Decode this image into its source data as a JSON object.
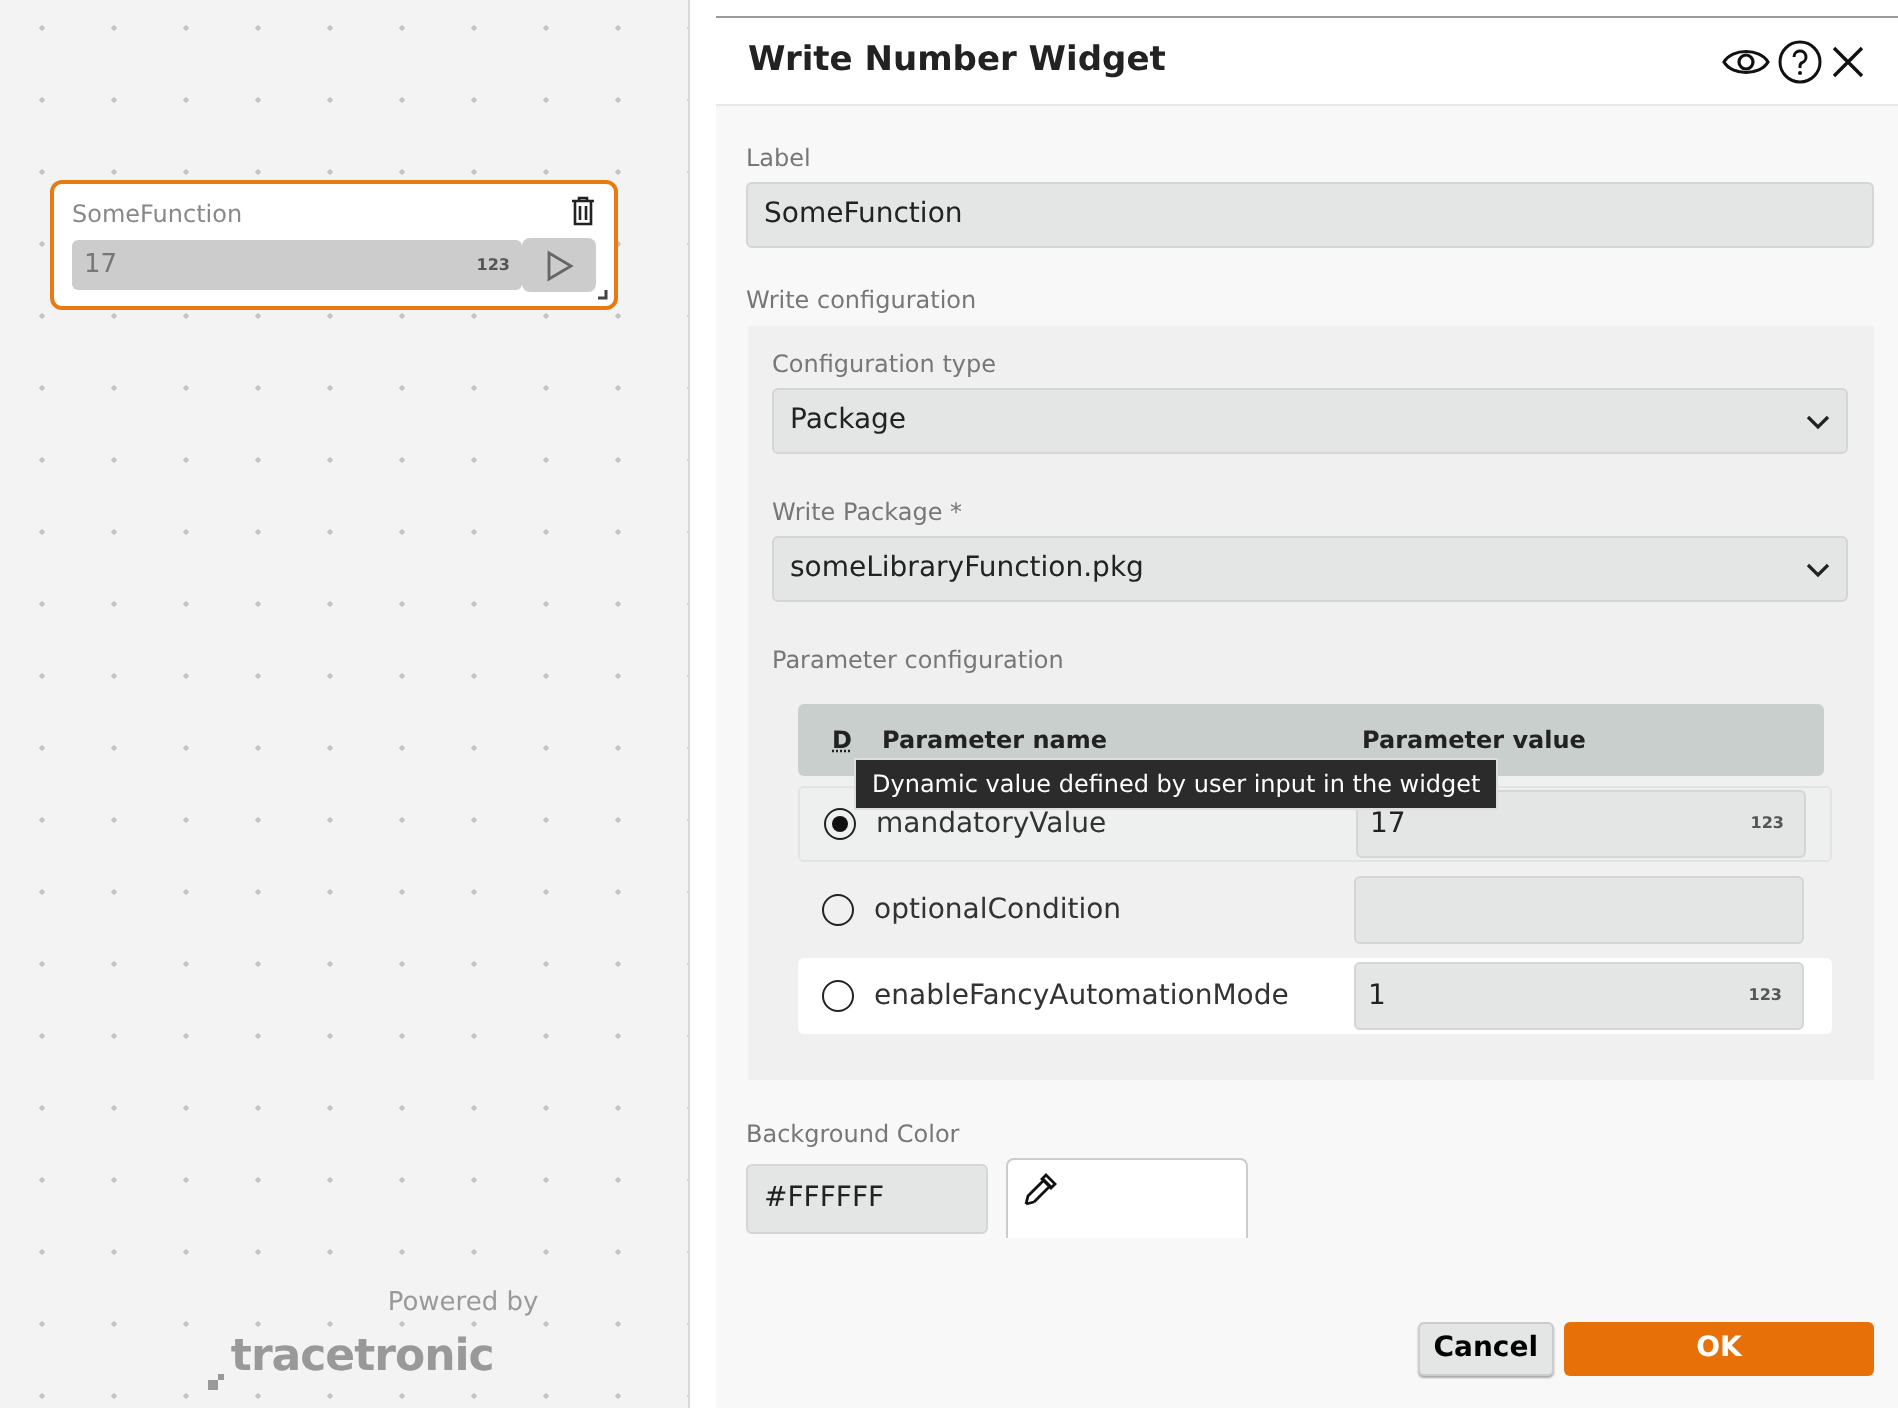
{
  "canvas": {
    "widget": {
      "label": "SomeFunction",
      "value": "17",
      "value_unit": "123",
      "selected": true
    },
    "footer": {
      "powered_by": "Powered by",
      "brand": "tracetronic"
    }
  },
  "dialog": {
    "title": "Write Number Widget",
    "label_field": {
      "label": "Label",
      "value": "SomeFunction"
    },
    "write_configuration": {
      "heading": "Write configuration",
      "configuration_type": {
        "label": "Configuration type",
        "value": "Package"
      },
      "write_package": {
        "label": "Write Package *",
        "value": "someLibraryFunction.pkg"
      },
      "parameter_configuration": {
        "heading": "Parameter configuration",
        "columns": [
          "D",
          "Parameter name",
          "Parameter value"
        ],
        "tooltip": "Dynamic value defined by user input in the widget",
        "rows": [
          {
            "name": "mandatoryValue",
            "value": "17",
            "unit": "123",
            "selected": true
          },
          {
            "name": "optionalCondition",
            "selected": false
          },
          {
            "name": "enableFancyAutomationMode",
            "value": "1",
            "unit": "123",
            "selected": false
          }
        ]
      }
    },
    "background_color": {
      "label": "Background Color",
      "value": "#FFFFFF"
    },
    "buttons": [
      {
        "label": "Cancel",
        "kind": "secondary"
      },
      {
        "label": "OK",
        "kind": "primary"
      }
    ]
  }
}
